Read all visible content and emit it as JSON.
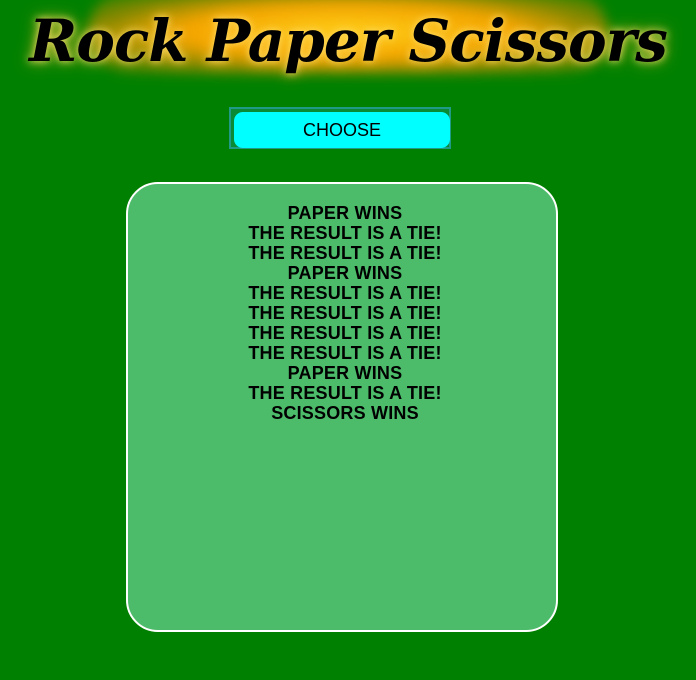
{
  "header": {
    "title": "Rock Paper Scissors"
  },
  "controls": {
    "choose_label": "CHOOSE"
  },
  "results": {
    "lines": [
      "PAPER WINS",
      "THE RESULT IS A TIE!",
      "THE RESULT IS A TIE!",
      "PAPER WINS",
      "THE RESULT IS A TIE!",
      "THE RESULT IS A TIE!",
      "THE RESULT IS A TIE!",
      "THE RESULT IS A TIE!",
      "PAPER WINS",
      "THE RESULT IS A TIE!",
      "SCISSORS WINS"
    ]
  },
  "colors": {
    "background": "#008000",
    "button": "#00ffff",
    "panel": "#4cbb6a",
    "title_glow": "#f4a400"
  }
}
